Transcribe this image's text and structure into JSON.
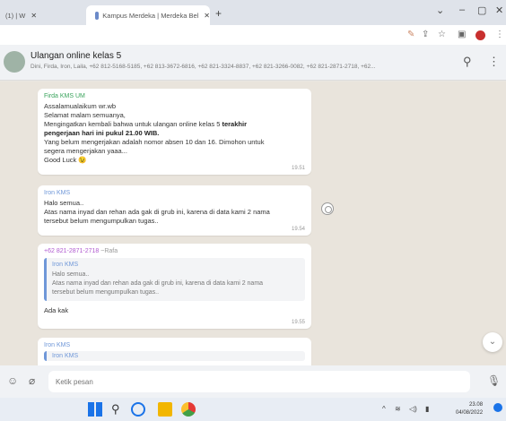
{
  "browser": {
    "tab1_label": "(1) | W",
    "tab2_label": "Kampus Merdeka | Merdeka Bel",
    "new_tab": "+",
    "controls": {
      "minimize": "⌄",
      "restore": "–",
      "maximize": "▢",
      "close": "✕"
    }
  },
  "chat": {
    "group_name": "Ulangan online kelas 5",
    "members": "Dini, Firda, Iron, Laila, +62 812-5168-5185, +62 813-3672-6816, +62 821-3324-8837, +62 821-3266-0082, +62 821-2871-2718, +62...",
    "messages": [
      {
        "sender": "Firda KMS UM",
        "sender_color": "#3aa35c",
        "line1": "Assalamualaikum wr.wb",
        "line2": "Selamat malam semuanya,",
        "line3_pre": "Mengingatkan kembali bahwa untuk ulangan online kelas 5 ",
        "line3_bold": "terakhir",
        "line4_bold": "pengerjaan hari ini pukul 21.00 WIB.",
        "line5": "Yang belum mengerjakan adalah nomor absen 10 dan 16. Dimohon untuk",
        "line6": "segera mengerjakan yaaa...",
        "line7": "Good Luck 😉",
        "time": "19.51"
      },
      {
        "sender": "Iron KMS",
        "sender_color": "#6f97d8",
        "line1": "Halo semua..",
        "line2": "Atas nama inyad dan rehan ada gak di grub ini, karena di data kami 2 nama",
        "line3": "tersebut belum mengumpulkan tugas..",
        "time": "19.54"
      },
      {
        "sender": "+62 821-2871-2718",
        "sender_alias": "~Rafa",
        "sender_color": "#b05ad0",
        "quote_sender": "Iron KMS",
        "quote_line1": "Halo semua..",
        "quote_line2": "Atas nama inyad dan rehan ada gak di grub ini, karena di data kami 2 nama",
        "quote_line3": "tersebut belum mengumpulkan tugas..",
        "reply": "Ada kak",
        "time": "19.55"
      },
      {
        "sender": "Iron KMS",
        "sender_color": "#6f97d8",
        "quote_sender": "Iron KMS"
      }
    ]
  },
  "compose": {
    "placeholder": "Ketik pesan"
  },
  "taskbar": {
    "time": "23.08",
    "date": "04/08/2022"
  }
}
